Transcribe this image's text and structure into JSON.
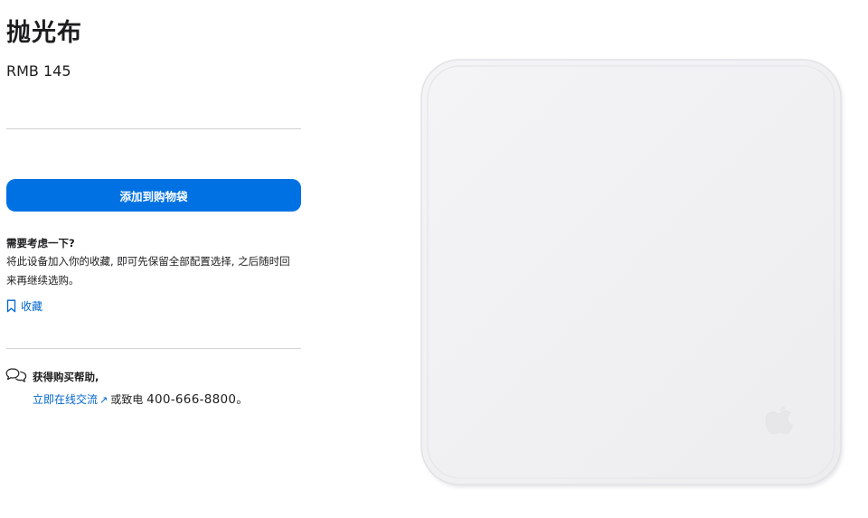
{
  "product": {
    "title": "抛光布",
    "price": "RMB 145",
    "image_icon": "apple-logo-icon"
  },
  "actions": {
    "add_to_bag_label": "添加到购物袋"
  },
  "consider": {
    "title": "需要考虑一下?",
    "body": "将此设备加入你的收藏, 即可先保留全部配置选择, 之后随时回来再继续选购。",
    "save_label": "收藏",
    "save_icon": "bookmark-icon"
  },
  "help": {
    "icon": "chat-bubbles-icon",
    "title": "获得购买帮助,",
    "chat_link_label": "立即在线交流",
    "chat_link_icon": "external-arrow-icon",
    "chat_link_arrow": "↗",
    "phone_prefix": "或致电",
    "phone": "400-666-8800。"
  },
  "colors": {
    "accent": "#0071e3",
    "link": "#0066cc",
    "text": "#1d1d1f",
    "divider": "#d2d2d7",
    "cloth": "#f1f1f3"
  }
}
